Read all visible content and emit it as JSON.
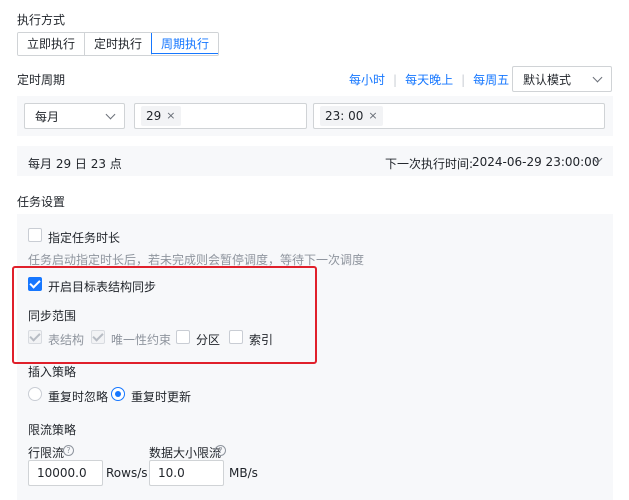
{
  "exec_mode": {
    "title": "执行方式",
    "options": [
      "立即执行",
      "定时执行",
      "周期执行"
    ],
    "selected": "周期执行"
  },
  "cycle": {
    "title": "定时周期",
    "quick_links": [
      "每小时",
      "每天晚上",
      "每周五"
    ],
    "mode_select": "默认模式",
    "period_select": "每月",
    "day_tag": "29",
    "time_tag": "23: 00",
    "tag_remove": "×"
  },
  "summary": {
    "text": "每月 29 日 23 点",
    "next_label": "下一次执行时间:",
    "next_value": "2024-06-29 23:00:00"
  },
  "task": {
    "title": "任务设置",
    "duration_label": "指定任务时长",
    "duration_checked": false,
    "duration_hint": "任务启动指定时长后，若未完成则会暂停调度，等待下一次调度",
    "sync_label": "开启目标表结构同步",
    "sync_checked": true,
    "scope_title": "同步范围",
    "scope_items": [
      {
        "label": "表结构",
        "checked": true,
        "disabled": true
      },
      {
        "label": "唯一性约束",
        "checked": true,
        "disabled": true
      },
      {
        "label": "分区",
        "checked": false,
        "disabled": false
      },
      {
        "label": "索引",
        "checked": false,
        "disabled": false
      }
    ],
    "insert_title": "插入策略",
    "insert_options": [
      "重复时忽略",
      "重复时更新"
    ],
    "insert_selected": "重复时更新",
    "limit_title": "限流策略",
    "row_limit_label": "行限流",
    "row_limit_value": "10000.0",
    "row_limit_unit": "Rows/s",
    "data_limit_label": "数据大小限流",
    "data_limit_value": "10.0",
    "data_limit_unit": "MB/s",
    "help_glyph": "?"
  },
  "colors": {
    "accent": "#1677ff",
    "highlight": "#e0202b",
    "panel_bg": "#f7f8fa"
  }
}
